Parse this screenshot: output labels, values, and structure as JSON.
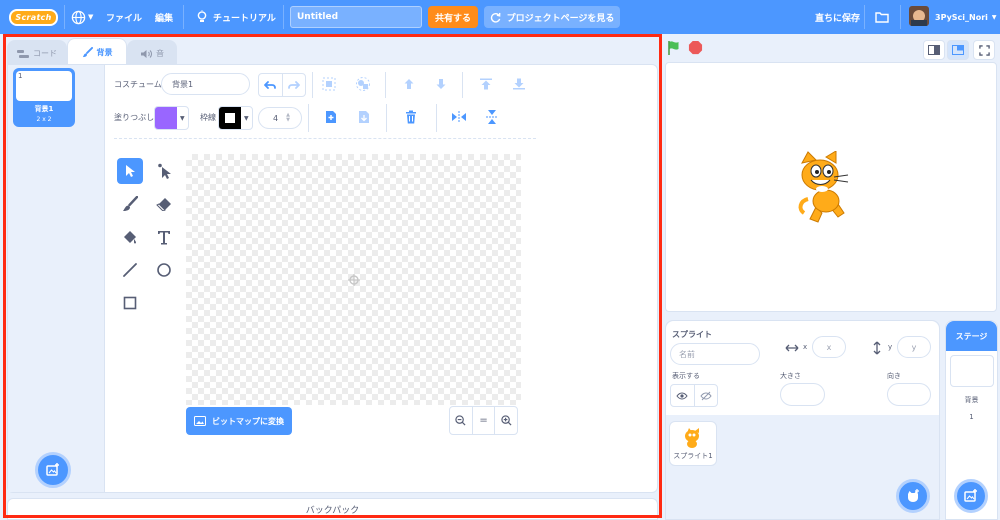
{
  "menubar": {
    "logo": "Scratch",
    "file": "ファイル",
    "edit": "編集",
    "tutorials": "チュートリアル",
    "project_title": "Untitled",
    "share": "共有する",
    "project_page": "プロジェクトページを見る",
    "save_now": "直ちに保存",
    "username": "3PySci_Nori"
  },
  "tabs": {
    "code": "コード",
    "backdrops": "背景",
    "sounds": "音"
  },
  "costume_list": {
    "items": [
      {
        "number": "1",
        "name": "背景1",
        "size": "2 x 2"
      }
    ]
  },
  "paint_editor": {
    "costume_label": "コスチューム",
    "costume_name": "背景1",
    "fill_label": "塗りつぶし",
    "fill_color": "#9966ff",
    "outline_label": "枠線",
    "outline_color": "#000000",
    "outline_width": "4",
    "convert_bitmap": "ビットマップに変換",
    "zoom_reset": "="
  },
  "backpack": "バックパック",
  "sprite_info": {
    "sprite_label": "スプライト",
    "name_placeholder": "名前",
    "x_label": "x",
    "x_placeholder": "x",
    "y_label": "y",
    "y_placeholder": "y",
    "show_label": "表示する",
    "size_label": "大きさ",
    "direction_label": "向き"
  },
  "sprites": [
    {
      "name": "スプライト1"
    }
  ],
  "stage_panel": {
    "title": "ステージ",
    "backdrops_label": "背景",
    "backdrop_count": "1"
  },
  "colors": {
    "accent": "#4c97ff",
    "share": "#ff8c1a",
    "highlight": "#ff2a12"
  }
}
